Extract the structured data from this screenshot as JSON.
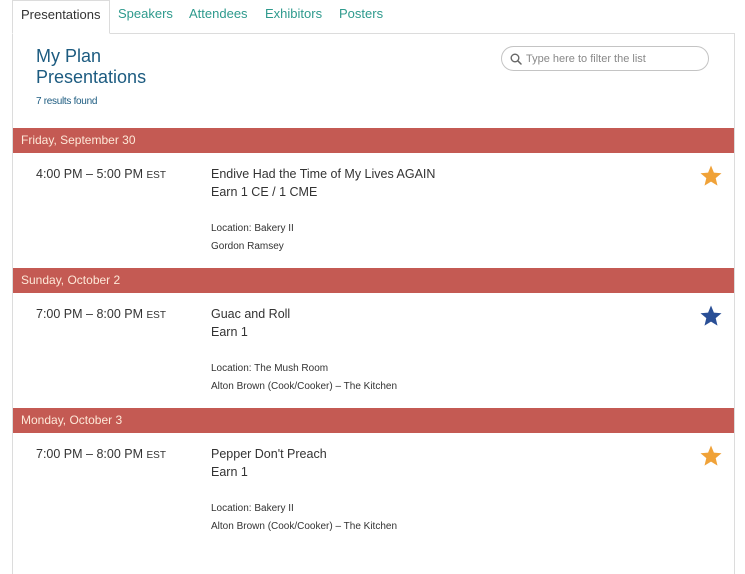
{
  "tabs": [
    {
      "label": "Presentations",
      "active": true
    },
    {
      "label": "Speakers",
      "active": false
    },
    {
      "label": "Attendees",
      "active": false
    },
    {
      "label": "Exhibitors",
      "active": false
    },
    {
      "label": "Posters",
      "active": false
    }
  ],
  "header": {
    "title_line1": "My Plan",
    "title_line2": "Presentations",
    "results": "7 results found"
  },
  "search": {
    "placeholder": "Type here to filter the list",
    "value": ""
  },
  "colors": {
    "day_bar": "#c45a53",
    "accent_teal": "#2e9a8d",
    "title_blue": "#1c5b80",
    "star_orange": "#f0a238",
    "star_blue": "#2a4f96"
  },
  "days": [
    {
      "label": "Friday, September 30",
      "session": {
        "time": "4:00 PM – 5:00 PM",
        "tz": "EST",
        "title": "Endive Had the Time of My Lives AGAIN",
        "credits": "Earn 1 CE / 1 CME",
        "location": "Location: Bakery II",
        "presenter": "Gordon Ramsey",
        "star": "orange-star-icon"
      }
    },
    {
      "label": "Sunday, October 2",
      "session": {
        "time": "7:00 PM – 8:00 PM",
        "tz": "EST",
        "title": "Guac and Roll",
        "credits": "Earn 1",
        "location": "Location: The Mush Room",
        "presenter": "Alton Brown (Cook/Cooker) – The Kitchen",
        "star": "blue-star-icon"
      }
    },
    {
      "label": "Monday, October 3",
      "session": {
        "time": "7:00 PM – 8:00 PM",
        "tz": "EST",
        "title": "Pepper Don't Preach",
        "credits": "Earn 1",
        "location": "Location: Bakery II",
        "presenter": "Alton Brown (Cook/Cooker) – The Kitchen",
        "star": "orange-star-icon"
      }
    }
  ]
}
